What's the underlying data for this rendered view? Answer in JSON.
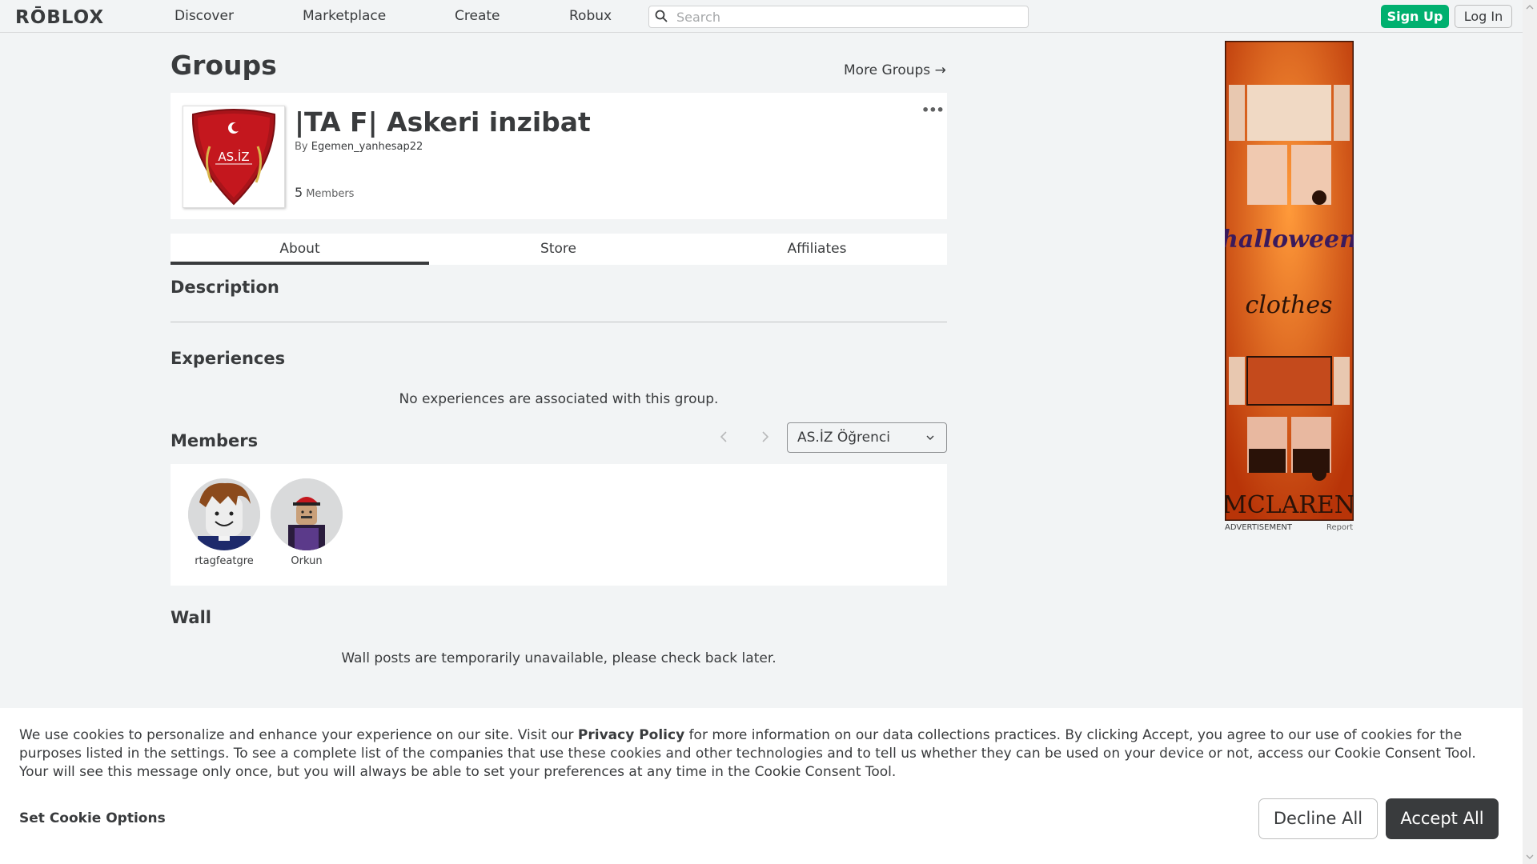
{
  "header": {
    "logo": "RŌBLOX",
    "nav": [
      "Discover",
      "Marketplace",
      "Create",
      "Robux"
    ],
    "search_placeholder": "Search",
    "signup_label": "Sign Up",
    "login_label": "Log In"
  },
  "page": {
    "title": "Groups",
    "more_groups": "More Groups →"
  },
  "group": {
    "name": "|TA F| Askeri inzibat",
    "by_label": "By",
    "owner": "Egemen_yanhesap22",
    "member_count": "5",
    "members_label": "Members",
    "emblem_text": "AS.İZ",
    "more_label": "•••"
  },
  "tabs": [
    {
      "label": "About",
      "active": true
    },
    {
      "label": "Store",
      "active": false
    },
    {
      "label": "Affiliates",
      "active": false
    }
  ],
  "sections": {
    "description": "Description",
    "experiences": "Experiences",
    "experiences_empty": "No experiences are associated with this group.",
    "members": "Members",
    "wall": "Wall",
    "wall_empty": "Wall posts are temporarily unavailable, please check back later."
  },
  "role_select": {
    "value": "AS.İZ Öğrenci"
  },
  "members": [
    {
      "name": "rtagfeatgre",
      "icon": "avatar-brown-hair"
    },
    {
      "name": "Orkun",
      "icon": "avatar-red-cap"
    }
  ],
  "ad": {
    "label": "ADVERTISEMENT",
    "report": "Report",
    "text_1": "halloween",
    "text_2": "clothes",
    "text_3": "MCLAREN",
    "colors": {
      "primary": "#d94e12",
      "dark": "#2a1208"
    }
  },
  "cookie": {
    "text_before": "We use cookies to personalize and enhance your experience on our site. Visit our ",
    "link": "Privacy Policy",
    "text_after": " for more information on our data collections practices. By clicking Accept, you agree to our use of cookies for the purposes listed in the settings. To see a complete list of the companies that use these cookies and other technologies and to tell us whether they can be used on your device or not, access our Cookie Consent Tool. Your will see this message only once, but you will always be able to set your preferences at any time in the Cookie Consent Tool.",
    "set_options": "Set Cookie Options",
    "decline": "Decline All",
    "accept": "Accept All"
  },
  "colors": {
    "signup_green": "#00b06f",
    "accept_dark": "#393b3d",
    "page_bg": "#f2f4f5"
  }
}
